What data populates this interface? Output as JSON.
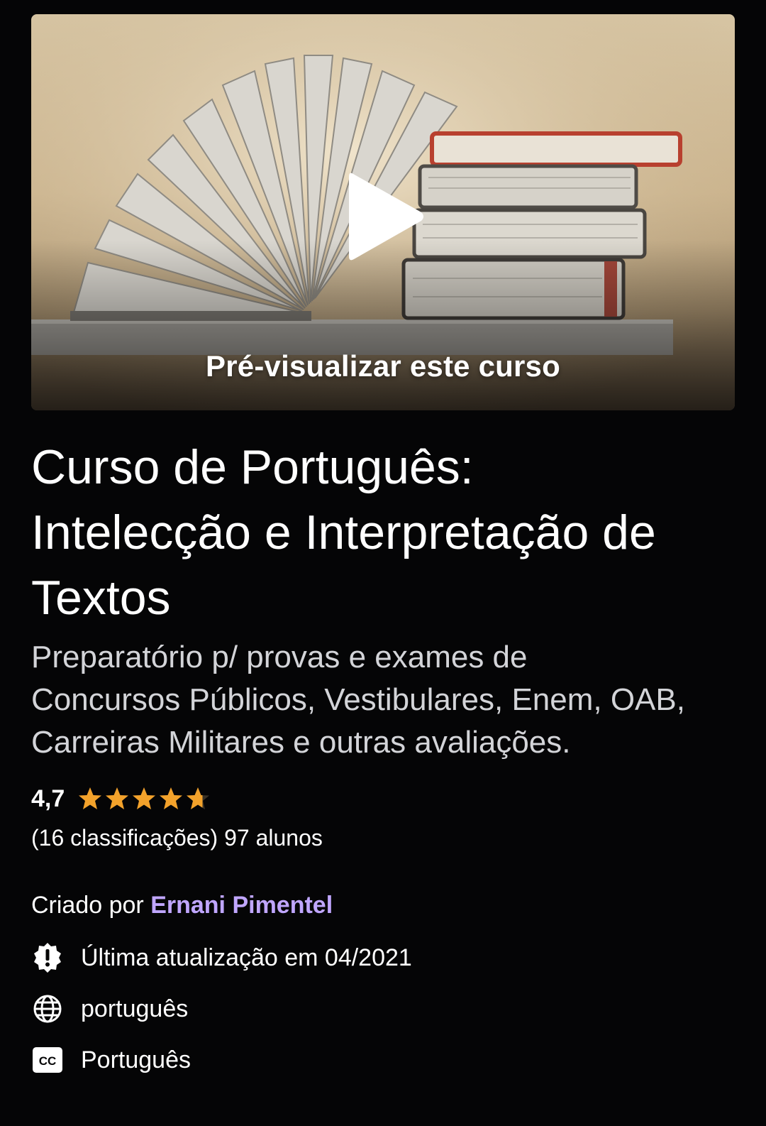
{
  "preview": {
    "label": "Pré-visualizar este curso",
    "play_icon": "play-icon"
  },
  "course": {
    "title_lines": [
      "Curso de Português:",
      "Intelecção e Interpretação de",
      "Textos"
    ],
    "subtitle_lines": [
      "Preparatório p/ provas e exames de",
      "Concursos Públicos, Vestibulares, Enem, OAB,",
      "Carreiras Militares e outras avaliações."
    ]
  },
  "rating": {
    "value": "4,7",
    "stars_filled": 4.7,
    "stars_total": 5,
    "star_color": "#f3a22b",
    "ratings_count": "(16 classificações)",
    "students": "97 alunos"
  },
  "creator": {
    "prefix": "Criado por",
    "name": "Ernani Pimentel",
    "link_color": "#c0a6ff"
  },
  "meta": {
    "updated": {
      "icon": "alert-badge-icon",
      "text": "Última atualização em 04/2021"
    },
    "language": {
      "icon": "globe-icon",
      "text": "português"
    },
    "captions": {
      "icon": "closed-captions-icon",
      "text": "Português"
    }
  }
}
